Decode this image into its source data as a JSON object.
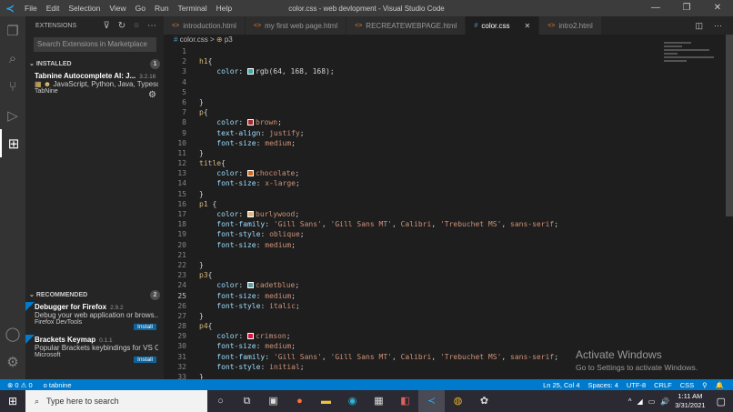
{
  "titlebar": {
    "menu": [
      "File",
      "Edit",
      "Selection",
      "View",
      "Go",
      "Run",
      "Terminal",
      "Help"
    ],
    "title": "color.css - web devlopment - Visual Studio Code"
  },
  "sidebar": {
    "header": "EXTENSIONS",
    "search_placeholder": "Search Extensions in Marketplace",
    "installed": {
      "label": "INSTALLED",
      "count": "1",
      "items": [
        {
          "name": "Tabnine Autocomplete AI: J...",
          "version": "3.2.16",
          "desc": "JavaScript, Python, Java, Typesc...",
          "publisher": "TabNine"
        }
      ]
    },
    "recommended": {
      "label": "RECOMMENDED",
      "count": "2",
      "items": [
        {
          "name": "Debugger for Firefox",
          "version": "2.9.2",
          "desc": "Debug your web application or brows...",
          "publisher": "Firefox DevTools",
          "action": "Install"
        },
        {
          "name": "Brackets Keymap",
          "version": "0.1.1",
          "desc": "Popular Brackets keybindings for VS C...",
          "publisher": "Microsoft",
          "action": "Install"
        }
      ]
    }
  },
  "tabs": [
    {
      "label": "introduction.html",
      "icon": "<>"
    },
    {
      "label": "my first  web page.html",
      "icon": "<>"
    },
    {
      "label": "RECREATEWEBPAGE.html",
      "icon": "<>"
    },
    {
      "label": "color.css",
      "icon": "#",
      "active": true
    },
    {
      "label": "intro2.html",
      "icon": "<>"
    }
  ],
  "breadcrumb": {
    "file": "color.css",
    "symbol": "p3"
  },
  "current_line": 25,
  "code": [
    {
      "t": []
    },
    {
      "t": [
        [
          "sel",
          "h1"
        ],
        [
          "plain",
          "{"
        ]
      ]
    },
    {
      "t": [
        [
          "plain",
          "    "
        ],
        [
          "prop",
          "color"
        ],
        [
          "plain",
          ": "
        ],
        [
          "sw",
          "#40a8a8"
        ],
        [
          "plain",
          "rgb(64, 168, 168);"
        ]
      ]
    },
    {
      "t": []
    },
    {
      "t": []
    },
    {
      "t": [
        [
          "plain",
          "}"
        ]
      ]
    },
    {
      "t": [
        [
          "sel",
          "p"
        ],
        [
          "plain",
          "{"
        ]
      ]
    },
    {
      "t": [
        [
          "plain",
          "    "
        ],
        [
          "prop",
          "color"
        ],
        [
          "plain",
          ": "
        ],
        [
          "sw",
          "#a52a2a"
        ],
        [
          "val",
          "brown"
        ],
        [
          "plain",
          ";"
        ]
      ]
    },
    {
      "t": [
        [
          "plain",
          "    "
        ],
        [
          "prop",
          "text-align"
        ],
        [
          "plain",
          ": "
        ],
        [
          "val",
          "justify"
        ],
        [
          "plain",
          ";"
        ]
      ]
    },
    {
      "t": [
        [
          "plain",
          "    "
        ],
        [
          "prop",
          "font-size"
        ],
        [
          "plain",
          ": "
        ],
        [
          "val",
          "medium"
        ],
        [
          "plain",
          ";"
        ]
      ]
    },
    {
      "t": [
        [
          "plain",
          "}"
        ]
      ]
    },
    {
      "t": [
        [
          "sel",
          "title"
        ],
        [
          "plain",
          "{"
        ]
      ]
    },
    {
      "t": [
        [
          "plain",
          "    "
        ],
        [
          "prop",
          "color"
        ],
        [
          "plain",
          ": "
        ],
        [
          "sw",
          "#d2691e"
        ],
        [
          "val",
          "chocolate"
        ],
        [
          "plain",
          ";"
        ]
      ]
    },
    {
      "t": [
        [
          "plain",
          "    "
        ],
        [
          "prop",
          "font-size"
        ],
        [
          "plain",
          ": "
        ],
        [
          "val",
          "x-large"
        ],
        [
          "plain",
          ";"
        ]
      ]
    },
    {
      "t": [
        [
          "plain",
          "}"
        ]
      ]
    },
    {
      "t": [
        [
          "sel",
          "p1"
        ],
        [
          "plain",
          " {"
        ]
      ]
    },
    {
      "t": [
        [
          "plain",
          "    "
        ],
        [
          "prop",
          "color"
        ],
        [
          "plain",
          ": "
        ],
        [
          "sw",
          "#deb887"
        ],
        [
          "val",
          "burlywood"
        ],
        [
          "plain",
          ";"
        ]
      ]
    },
    {
      "t": [
        [
          "plain",
          "    "
        ],
        [
          "prop",
          "font-family"
        ],
        [
          "plain",
          ": "
        ],
        [
          "val",
          "'Gill Sans'"
        ],
        [
          "plain",
          ", "
        ],
        [
          "val",
          "'Gill Sans MT'"
        ],
        [
          "plain",
          ", "
        ],
        [
          "val",
          "Calibri"
        ],
        [
          "plain",
          ", "
        ],
        [
          "val",
          "'Trebuchet MS'"
        ],
        [
          "plain",
          ", "
        ],
        [
          "val",
          "sans-serif"
        ],
        [
          "plain",
          ";"
        ]
      ]
    },
    {
      "t": [
        [
          "plain",
          "    "
        ],
        [
          "prop",
          "font-style"
        ],
        [
          "plain",
          ": "
        ],
        [
          "val",
          "oblique"
        ],
        [
          "plain",
          ";"
        ]
      ]
    },
    {
      "t": [
        [
          "plain",
          "    "
        ],
        [
          "prop",
          "font-size"
        ],
        [
          "plain",
          ": "
        ],
        [
          "val",
          "medium"
        ],
        [
          "plain",
          ";"
        ]
      ]
    },
    {
      "t": []
    },
    {
      "t": [
        [
          "plain",
          "}"
        ]
      ]
    },
    {
      "t": [
        [
          "sel",
          "p3"
        ],
        [
          "plain",
          "{"
        ]
      ]
    },
    {
      "t": [
        [
          "plain",
          "    "
        ],
        [
          "prop",
          "color"
        ],
        [
          "plain",
          ": "
        ],
        [
          "sw",
          "#5f9ea0"
        ],
        [
          "val",
          "cadetblue"
        ],
        [
          "plain",
          ";"
        ]
      ]
    },
    {
      "t": [
        [
          "plain",
          "    "
        ],
        [
          "prop",
          "font-size"
        ],
        [
          "plain",
          ": "
        ],
        [
          "val",
          "medium"
        ],
        [
          "plain",
          ";"
        ]
      ]
    },
    {
      "t": [
        [
          "plain",
          "    "
        ],
        [
          "prop",
          "font-style"
        ],
        [
          "plain",
          ": "
        ],
        [
          "val",
          "italic"
        ],
        [
          "plain",
          ";"
        ]
      ]
    },
    {
      "t": [
        [
          "plain",
          "}"
        ]
      ]
    },
    {
      "t": [
        [
          "sel",
          "p4"
        ],
        [
          "plain",
          "{"
        ]
      ]
    },
    {
      "t": [
        [
          "plain",
          "    "
        ],
        [
          "prop",
          "color"
        ],
        [
          "plain",
          ": "
        ],
        [
          "sw",
          "#dc143c"
        ],
        [
          "val",
          "crimson"
        ],
        [
          "plain",
          ";"
        ]
      ]
    },
    {
      "t": [
        [
          "plain",
          "    "
        ],
        [
          "prop",
          "font-size"
        ],
        [
          "plain",
          ": "
        ],
        [
          "val",
          "medium"
        ],
        [
          "plain",
          ";"
        ]
      ]
    },
    {
      "t": [
        [
          "plain",
          "    "
        ],
        [
          "prop",
          "font-family"
        ],
        [
          "plain",
          ": "
        ],
        [
          "val",
          "'Gill Sans'"
        ],
        [
          "plain",
          ", "
        ],
        [
          "val",
          "'Gill Sans MT'"
        ],
        [
          "plain",
          ", "
        ],
        [
          "val",
          "Calibri"
        ],
        [
          "plain",
          ", "
        ],
        [
          "val",
          "'Trebuchet MS'"
        ],
        [
          "plain",
          ", "
        ],
        [
          "val",
          "sans-serif"
        ],
        [
          "plain",
          ";"
        ]
      ]
    },
    {
      "t": [
        [
          "plain",
          "    "
        ],
        [
          "prop",
          "font-style"
        ],
        [
          "plain",
          ": "
        ],
        [
          "val",
          "initial"
        ],
        [
          "plain",
          ";"
        ]
      ]
    },
    {
      "t": [
        [
          "plain",
          "}"
        ]
      ]
    }
  ],
  "watermark": {
    "title": "Activate Windows",
    "subtitle": "Go to Settings to activate Windows."
  },
  "status": {
    "errors": "0",
    "warnings": "0",
    "tabnine": "tabnine",
    "position": "Ln 25, Col 4",
    "spaces": "Spaces: 4",
    "encoding": "UTF-8",
    "eol": "CRLF",
    "language": "CSS"
  },
  "taskbar": {
    "search_placeholder": "Type here to search",
    "time": "1:11 AM",
    "date": "3/31/2021"
  }
}
